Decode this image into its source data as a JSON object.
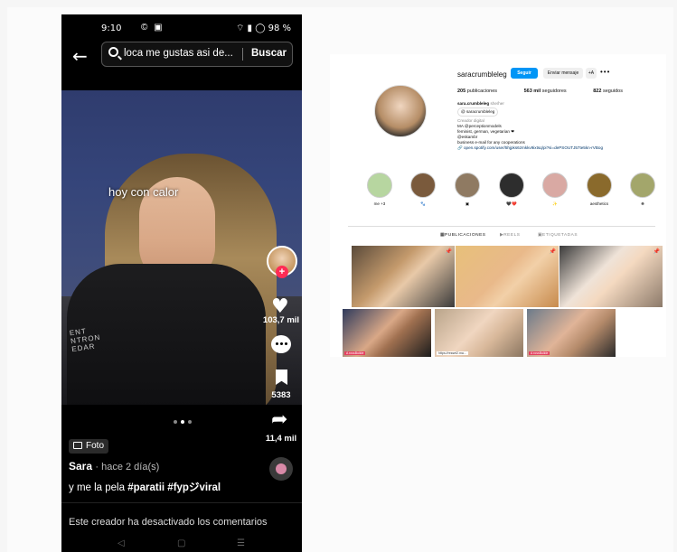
{
  "phone": {
    "status": {
      "time": "9:10",
      "icons_left": "© ▣",
      "battery": "98 %"
    },
    "search": {
      "query": "loca me gustas asi de...",
      "button": "Buscar"
    },
    "overlay_text": "hoy con calor",
    "jacket_print": "ENT\nNTRON\nEDAR",
    "likes": "103,7 mil",
    "saves": "5383",
    "shares": "11,4 mil",
    "follow_plus": "+",
    "post_type": "Foto",
    "author": "Sara",
    "posted": "· hace 2 día(s)",
    "caption_text": "y me la pela ",
    "caption_tags": "#paratii #fypジviral",
    "comments_disabled": "Este creador ha desactivado los comentarios"
  },
  "instagram": {
    "username": "saracrumbleleg",
    "follow_label": "Seguir",
    "message_label": "Enviar mensaje",
    "add_label": "+A",
    "more_label": "•••",
    "stats": {
      "posts_count": "205",
      "posts_label": "publicaciones",
      "followers_count": "563 mil",
      "followers_label": "seguidores",
      "following_count": "822",
      "following_label": "seguidos"
    },
    "bio": {
      "name": "sara.crumbleleg",
      "pronouns": "she/her",
      "threads_chip": "saracrumbleleg",
      "category": "Creador digital",
      "line1": "MA @perceptionmodels",
      "line2": "feminist, german, vegetarian ❤",
      "line3": "@eskambr",
      "line4": "business e-mail for any cooperations",
      "link": "open.spotify.com/user/5hjpks6zmkkv9ixtsq/pi?si=dePSOUTJ57te5kn-rVBog"
    },
    "highlights": [
      {
        "label": "me +3",
        "color": "#b7d6a0"
      },
      {
        "label": "🐾",
        "color": "#7a5a3c"
      },
      {
        "label": "▣",
        "color": "#8f7a62"
      },
      {
        "label": "🖤❤️",
        "color": "#2d2d2d"
      },
      {
        "label": "✨",
        "color": "#d9a9a3"
      },
      {
        "label": "aesthetics",
        "color": "#8a6a2c"
      },
      {
        "label": "❋",
        "color": "#a3a66b"
      }
    ],
    "tabs": {
      "posts": "PUBLICACIONES",
      "reels": "REELS",
      "tagged": "ETIQUETADAS"
    },
    "tile_pin": "📌",
    "tile_label_1": "A rossBuilde",
    "tile_label_2": "https://resset2.ma...",
    "tile_label_3": "A rossBuilde"
  }
}
